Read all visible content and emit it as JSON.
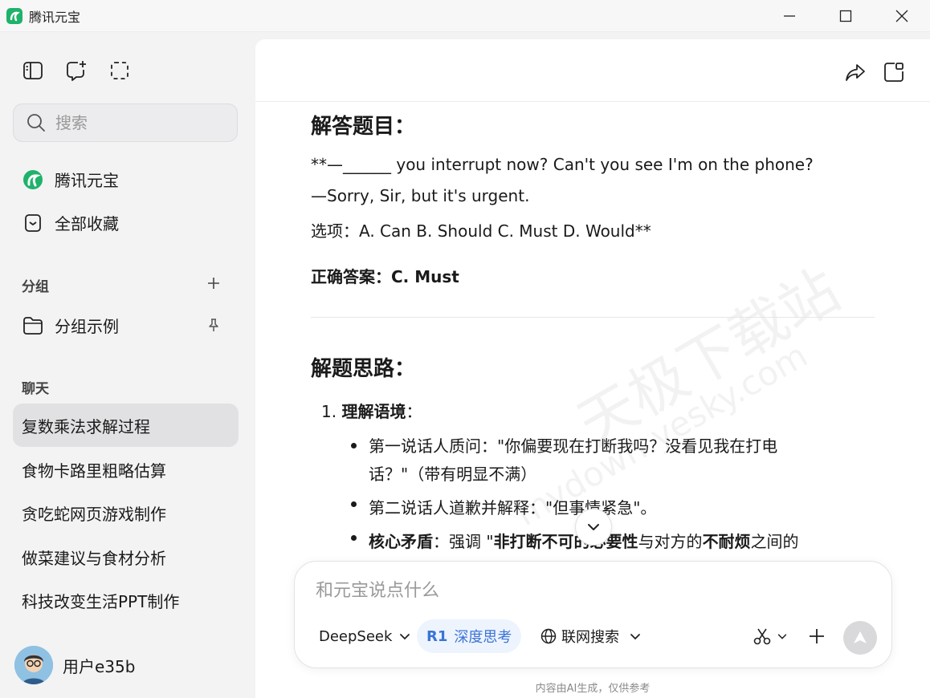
{
  "window": {
    "title": "腾讯元宝"
  },
  "sidebar": {
    "search_placeholder": "搜索",
    "nav": [
      {
        "label": "腾讯元宝",
        "icon": "yuanbao-logo-icon"
      },
      {
        "label": "全部收藏",
        "icon": "bookmark-icon"
      }
    ],
    "groups_label": "分组",
    "group_items": [
      {
        "label": "分组示例",
        "icon": "folder-icon"
      }
    ],
    "chats_label": "聊天",
    "chats": [
      {
        "label": "复数乘法求解过程",
        "active": true
      },
      {
        "label": "食物卡路里粗略估算",
        "active": false
      },
      {
        "label": "贪吃蛇网页游戏制作",
        "active": false
      },
      {
        "label": "做菜建议与食材分析",
        "active": false
      },
      {
        "label": "科技改变生活PPT制作",
        "active": false
      }
    ],
    "user_name": "用户e35b"
  },
  "content": {
    "heading1": "解答题目：",
    "q_line1": "**—______ you interrupt now? Can't you see I'm on the phone?",
    "q_line2": "—Sorry, Sir, but it's urgent.",
    "q_line3": "选项：A. Can B. Should C. Must D. Would**",
    "answer_label": "正确答案：",
    "answer_value": "C. Must",
    "heading2": "解题思路：",
    "step1_num": "1.",
    "step1_title": "理解语境",
    "step1_colon": "：",
    "b1_a": "第一说话人质问：\"你偏要现在打断我吗？没看见我在打电",
    "b1_b": "话？\"（带有明显不满）",
    "b2": "第二说话人道歉并解释：\"但事情紧急\"。",
    "b3_label": "核心矛盾",
    "b3_t1": "：强调 \"",
    "b3_bold1": "非打断不可的必要性",
    "b3_t2": "与对方的",
    "b3_bold2": "不耐烦",
    "b3_t3": "之间的",
    "watermark": "天极下载站",
    "watermark_url": "mydown.yesky.com"
  },
  "composer": {
    "placeholder": "和元宝说点什么",
    "model": "DeepSeek",
    "deep_think_badge": "R1",
    "deep_think_label": "深度思考",
    "web_search_label": "联网搜索"
  },
  "footer_note": "内容由AI生成，仅供参考",
  "colors": {
    "accent": "#3a74d6",
    "brand_green": "#1fb26a"
  }
}
